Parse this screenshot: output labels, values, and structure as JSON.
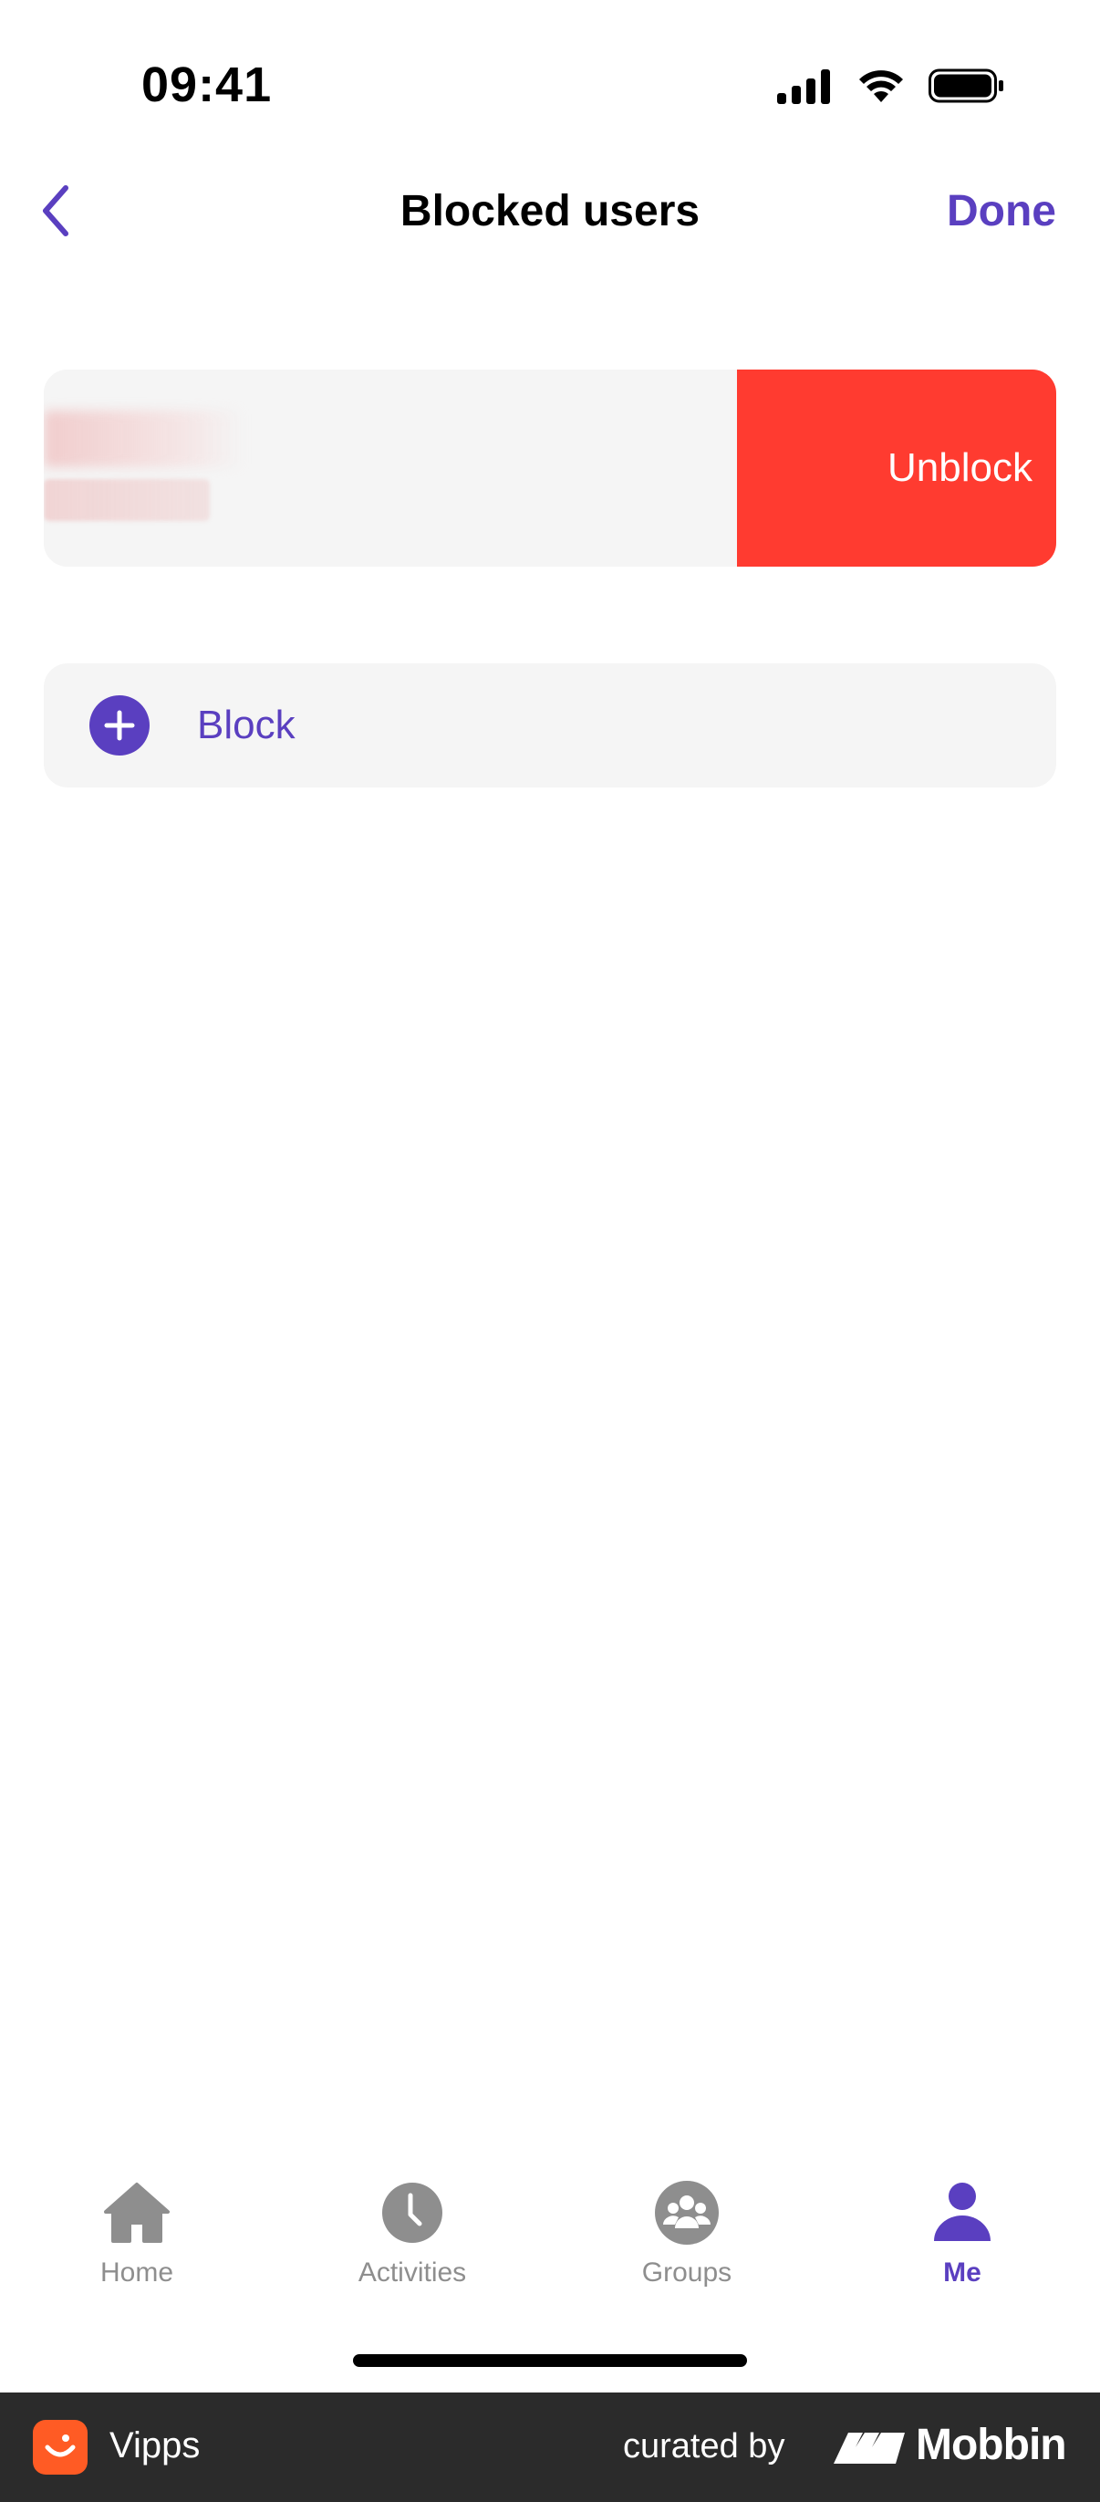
{
  "status_bar": {
    "time": "09:41"
  },
  "nav": {
    "title": "Blocked users",
    "done_label": "Done"
  },
  "blocked_row": {
    "unblock_label": "Unblock"
  },
  "block_action": {
    "label": "Block"
  },
  "tabs": [
    {
      "label": "Home",
      "icon": "home-icon",
      "active": false
    },
    {
      "label": "Activities",
      "icon": "clock-icon",
      "active": false
    },
    {
      "label": "Groups",
      "icon": "group-icon",
      "active": false
    },
    {
      "label": "Me",
      "icon": "person-icon",
      "active": true
    }
  ],
  "footer": {
    "app_name": "Vipps",
    "curated_by": "curated by",
    "brand": "Mobbin"
  },
  "colors": {
    "accent": "#5a3fc0",
    "destructive": "#ff3b30",
    "card": "#f5f5f5",
    "inactive": "#8e8e8e"
  }
}
